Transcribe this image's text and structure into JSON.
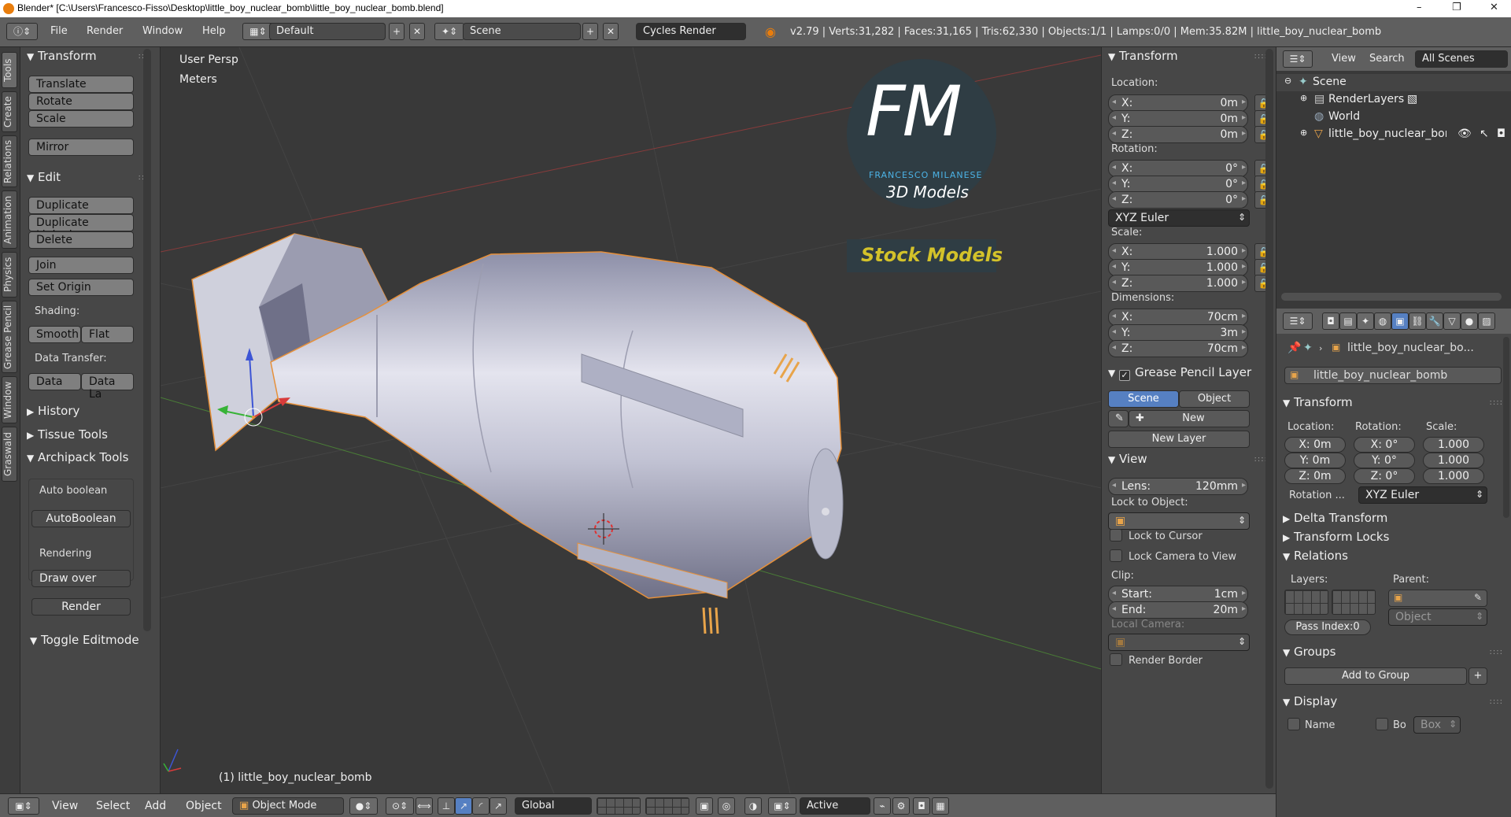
{
  "window": {
    "title": "Blender* [C:\\Users\\Francesco-Fisso\\Desktop\\little_boy_nuclear_bomb\\little_boy_nuclear_bomb.blend]",
    "minimize": "–",
    "maximize": "❐",
    "close": "✕"
  },
  "info": {
    "menus": [
      "File",
      "Render",
      "Window",
      "Help"
    ],
    "layout": "Default",
    "scene": "Scene",
    "engine": "Cycles Render",
    "stats": "v2.79 | Verts:31,282 | Faces:31,165 | Tris:62,330 | Objects:1/1 | Lamps:0/0 | Mem:35.82M | little_boy_nuclear_bomb"
  },
  "left_tabs": [
    "Tools",
    "Create",
    "Relations",
    "Animation",
    "Physics",
    "Grease Pencil",
    "Window",
    "Graswald"
  ],
  "tools": {
    "transform_header": "Transform",
    "translate": "Translate",
    "rotate": "Rotate",
    "scale": "Scale",
    "mirror": "Mirror",
    "edit_header": "Edit",
    "duplicate": "Duplicate",
    "duplicate_linked": "Duplicate Linked",
    "delete": "Delete",
    "join": "Join",
    "set_origin": "Set Origin",
    "shading_label": "Shading:",
    "smooth": "Smooth",
    "flat": "Flat",
    "data_transfer_label": "Data Transfer:",
    "data": "Data",
    "data_la": "Data La",
    "history": "History",
    "tissue": "Tissue Tools",
    "archipack": "Archipack Tools",
    "auto_boolean_label": "Auto boolean",
    "auto_boolean_btn": "AutoBoolean",
    "rendering_label": "Rendering",
    "draw_over": "Draw over",
    "render": "Render",
    "toggle_editmode": "Toggle Editmode"
  },
  "viewport": {
    "view_name": "User Persp",
    "units": "Meters",
    "object_label": "(1) little_boy_nuclear_bomb",
    "logo": {
      "letters": "FM",
      "name": "FRANCESCO MILANESE",
      "sub": "3D Models",
      "stock": "Stock Models"
    }
  },
  "npanel": {
    "transform": "Transform",
    "location_label": "Location:",
    "loc": [
      {
        "k": "X:",
        "v": "0m"
      },
      {
        "k": "Y:",
        "v": "0m"
      },
      {
        "k": "Z:",
        "v": "0m"
      }
    ],
    "rotation_label": "Rotation:",
    "rot": [
      {
        "k": "X:",
        "v": "0°"
      },
      {
        "k": "Y:",
        "v": "0°"
      },
      {
        "k": "Z:",
        "v": "0°"
      }
    ],
    "rot_mode": "XYZ Euler",
    "scale_label": "Scale:",
    "scl": [
      {
        "k": "X:",
        "v": "1.000"
      },
      {
        "k": "Y:",
        "v": "1.000"
      },
      {
        "k": "Z:",
        "v": "1.000"
      }
    ],
    "dimensions_label": "Dimensions:",
    "dim": [
      {
        "k": "X:",
        "v": "70cm"
      },
      {
        "k": "Y:",
        "v": "3m"
      },
      {
        "k": "Z:",
        "v": "70cm"
      }
    ],
    "gp_header": "Grease Pencil Layer",
    "gp_scene": "Scene",
    "gp_object": "Object",
    "gp_new": "New",
    "gp_new_layer": "New Layer",
    "view_header": "View",
    "lens_k": "Lens:",
    "lens_v": "120mm",
    "lock_obj_label": "Lock to Object:",
    "lock_cursor": "Lock to Cursor",
    "lock_camera": "Lock Camera to View",
    "clip_label": "Clip:",
    "start_k": "Start:",
    "start_v": "1cm",
    "end_k": "End:",
    "end_v": "20m",
    "local_camera": "Local Camera:",
    "render_border": "Render Border"
  },
  "outliner": {
    "view": "View",
    "search": "Search",
    "all_scenes": "All Scenes",
    "rows": [
      "Scene",
      "RenderLayers",
      "World",
      "little_boy_nuclear_bom"
    ]
  },
  "props": {
    "crumb": "little_boy_nuclear_bo...",
    "name": "little_boy_nuclear_bomb",
    "transform": "Transform",
    "loc_label": "Location:",
    "rot_label": "Rotation:",
    "scl_label": "Scale:",
    "loc": [
      "X: 0m",
      "Y: 0m",
      "Z: 0m"
    ],
    "rot": [
      "X:  0°",
      "Y:  0°",
      "Z:  0°"
    ],
    "scl": [
      "1.000",
      "1.000",
      "1.000"
    ],
    "rot_mode_label": "Rotation ...",
    "rot_mode": "XYZ Euler",
    "delta": "Delta Transform",
    "locks": "Transform Locks",
    "relations": "Relations",
    "layers_label": "Layers:",
    "parent_label": "Parent:",
    "parent_type": "Object",
    "pass_index": "Pass Index:0",
    "groups": "Groups",
    "add_group": "Add to Group",
    "display": "Display",
    "name_chk": "Name",
    "bo_chk": "Bo",
    "box": "Box"
  },
  "bottom": {
    "menus": [
      "View",
      "Select",
      "Add",
      "Object"
    ],
    "mode": "Object Mode",
    "orientation": "Global",
    "pivot": "Active"
  }
}
